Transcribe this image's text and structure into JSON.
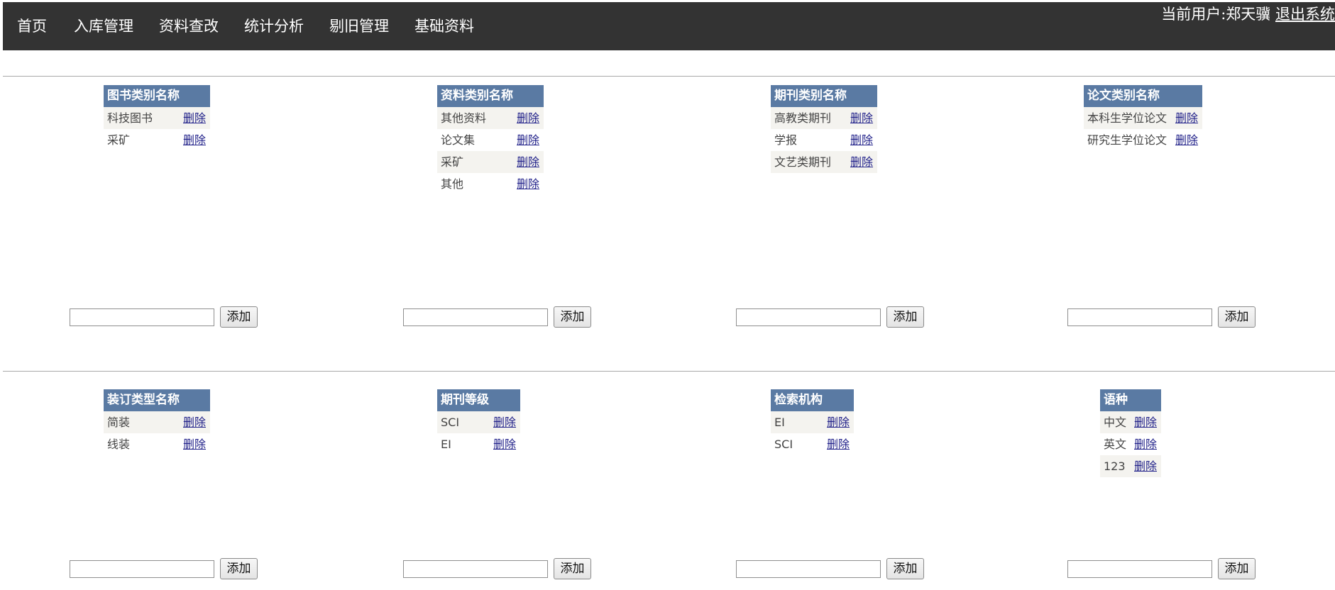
{
  "nav": {
    "items": [
      "首页",
      "入库管理",
      "资料查改",
      "统计分析",
      "剔旧管理",
      "基础资料"
    ],
    "user_prefix": "当前用户:郑天骥",
    "logout": "退出系统"
  },
  "delete_label": "删除",
  "add_label": "添加",
  "panels": [
    {
      "header": "图书类别名称",
      "items": [
        "科技图书",
        "采矿"
      ]
    },
    {
      "header": "资料类别名称",
      "items": [
        "其他资料",
        "论文集",
        "采矿",
        "其他"
      ]
    },
    {
      "header": "期刊类别名称",
      "items": [
        "高教类期刊",
        "学报",
        "文艺类期刊"
      ]
    },
    {
      "header": "论文类别名称",
      "items": [
        "本科生学位论文",
        "研究生学位论文"
      ]
    },
    {
      "header": "装订类型名称",
      "items": [
        "简装",
        "线装"
      ]
    },
    {
      "header": "期刊等级",
      "items": [
        "SCI",
        "EI"
      ]
    },
    {
      "header": "检索机构",
      "items": [
        "EI",
        "SCI"
      ]
    },
    {
      "header": "语种",
      "items": [
        "中文",
        "英文",
        "123"
      ]
    }
  ],
  "colors": {
    "topbar": "#333333",
    "header": "#5a7aa3",
    "row_alt": "#f4f3ef",
    "link": "#22228a"
  }
}
